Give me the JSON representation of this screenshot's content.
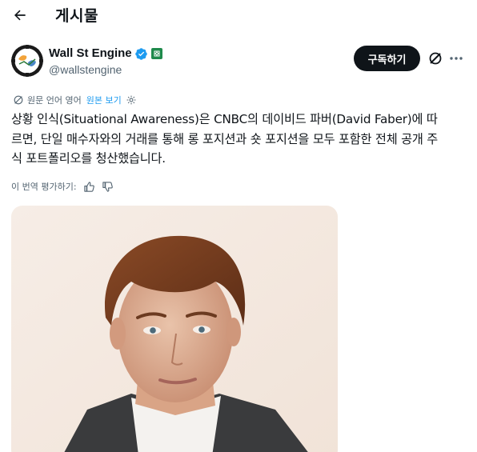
{
  "header": {
    "title": "게시물",
    "back_icon": "arrow-left-icon"
  },
  "author": {
    "name": "Wall St Engine",
    "handle": "@wallstengine",
    "verified": true,
    "verified_color": "#1d9bf0",
    "affiliation_color": "#1f8a4c"
  },
  "actions": {
    "subscribe_label": "구독하기"
  },
  "translation": {
    "note": "원문 언어 영어",
    "show_original": "원본 보기"
  },
  "post": {
    "lines": [
      "상황 인식(Situational Awareness)은 CNBC의 데이비드 파버(David Faber)에 따",
      "르면, 단일 매수자와의 거래를 통해 롱 포지션과 숏 포지션을 모두 포함한 전체 공개 주",
      "식 포트폴리오를 청산했습니다."
    ]
  },
  "rating": {
    "label": "이 번역 평가하기:"
  },
  "colors": {
    "accent": "#1d9bf0",
    "text": "#0f1419",
    "muted": "#536471"
  }
}
